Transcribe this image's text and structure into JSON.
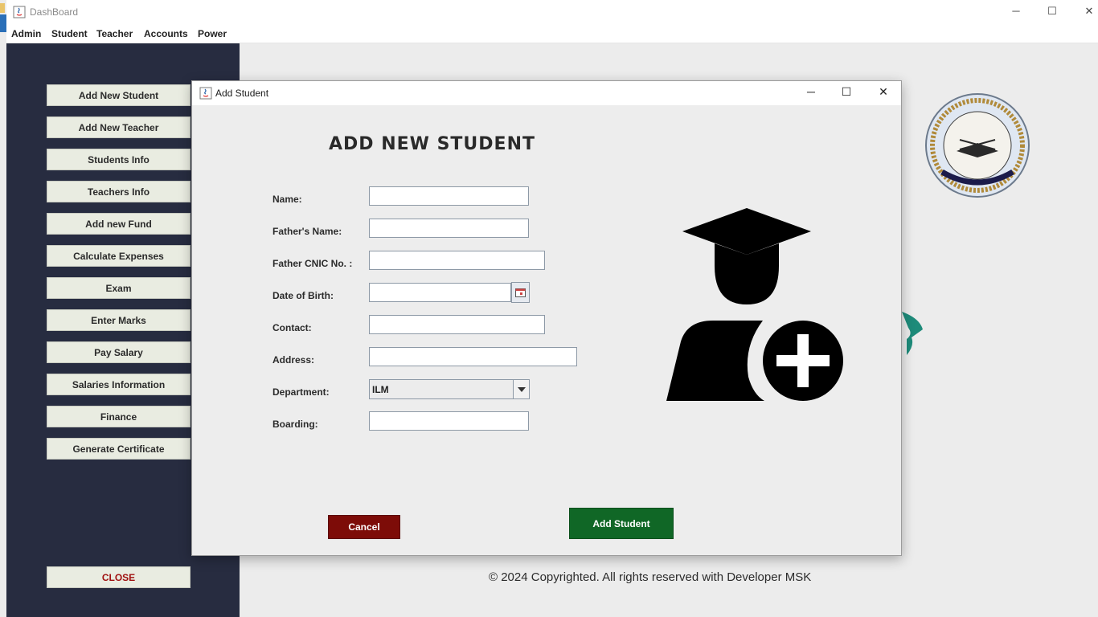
{
  "app": {
    "window_title": "DashBoard",
    "window_controls": {
      "minimize": "─",
      "maximize": "☐",
      "close": "✕"
    }
  },
  "menubar": {
    "items": [
      {
        "label": "Admin"
      },
      {
        "label": "Student"
      },
      {
        "label": "Teacher"
      },
      {
        "label": "Accounts"
      },
      {
        "label": "Power"
      }
    ]
  },
  "sidebar": {
    "buttons": [
      {
        "label": "Add New Student"
      },
      {
        "label": "Add New Teacher"
      },
      {
        "label": "Students Info"
      },
      {
        "label": "Teachers Info"
      },
      {
        "label": "Add new Fund"
      },
      {
        "label": "Calculate Expenses"
      },
      {
        "label": "Exam"
      },
      {
        "label": "Enter Marks"
      },
      {
        "label": "Pay Salary"
      },
      {
        "label": "Salaries Information"
      },
      {
        "label": "Finance"
      },
      {
        "label": "Generate Certificate"
      }
    ],
    "close_label": "CLOSE"
  },
  "footer": {
    "copyright": "© 2024 Copyrighted. All rights reserved with Developer MSK"
  },
  "dialog": {
    "title": "Add Student",
    "controls": {
      "minimize": "─",
      "maximize": "☐",
      "close": "✕"
    },
    "heading": "ADD NEW STUDENT",
    "fields": {
      "name": {
        "label": "Name:",
        "value": ""
      },
      "father_name": {
        "label": "Father's Name:",
        "value": ""
      },
      "father_cnic": {
        "label": "Father CNIC No. :",
        "value": ""
      },
      "dob": {
        "label": "Date of Birth:",
        "value": ""
      },
      "contact": {
        "label": "Contact:",
        "value": ""
      },
      "address": {
        "label": "Address:",
        "value": ""
      },
      "department": {
        "label": "Department:",
        "value": "ILM"
      },
      "boarding": {
        "label": "Boarding:",
        "value": ""
      }
    },
    "cancel_label": "Cancel",
    "submit_label": "Add Student"
  },
  "colors": {
    "sidebar_bg": "#272c40",
    "cancel_bg": "#7d0c08",
    "submit_bg": "#106726",
    "close_text": "#a01010"
  },
  "icons": [
    "java-app-icon",
    "calendar-icon",
    "dropdown-arrow-icon",
    "student-add-icon",
    "institution-logo"
  ]
}
